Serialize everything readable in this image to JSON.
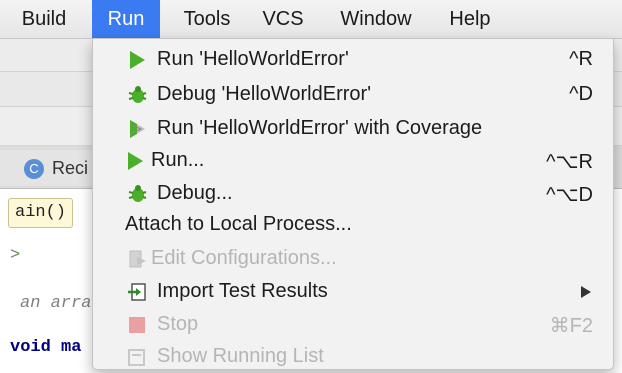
{
  "menubar": {
    "items": [
      {
        "label": "Build"
      },
      {
        "label": "Run"
      },
      {
        "label": "Tools"
      },
      {
        "label": "VCS"
      },
      {
        "label": "Window"
      },
      {
        "label": "Help"
      }
    ],
    "active": "Run"
  },
  "background": {
    "tab_label": "Reci",
    "tab_icon_letter": "C",
    "breadcrumb": "ain()",
    "gutter_mark": ">",
    "comment_fragment": "an arra",
    "code_fragment": "void ma"
  },
  "run_menu": {
    "items": [
      {
        "label": "Run 'HelloWorldError'",
        "shortcut": "^R",
        "icon": "run-play-icon",
        "enabled": true
      },
      {
        "label": "Debug 'HelloWorldError'",
        "shortcut": "^D",
        "icon": "debug-bug-icon",
        "enabled": true
      },
      {
        "label": "Run 'HelloWorldError' with Coverage",
        "shortcut": "",
        "icon": "coverage-icon",
        "enabled": true
      },
      {
        "label": "Run...",
        "shortcut": "^⌥R",
        "icon": "run-play-icon",
        "enabled": true
      },
      {
        "label": "Debug...",
        "shortcut": "^⌥D",
        "icon": "debug-bug-icon",
        "enabled": true
      },
      {
        "label": "Attach to Local Process...",
        "shortcut": "",
        "icon": "",
        "enabled": true
      },
      {
        "label": "Edit Configurations...",
        "shortcut": "",
        "icon": "edit-config-icon",
        "enabled": false
      },
      {
        "label": "Import Test Results",
        "shortcut": "",
        "icon": "import-icon",
        "enabled": true,
        "submenu": true
      },
      {
        "label": "Stop",
        "shortcut": "⌘F2",
        "icon": "stop-icon",
        "enabled": false
      },
      {
        "label": "Show Running List",
        "shortcut": "",
        "icon": "list-icon",
        "enabled": false
      }
    ]
  },
  "colors": {
    "accent": "#3a7bf2",
    "run_green": "#4caf2a",
    "stop_red": "#e8a0a0"
  }
}
